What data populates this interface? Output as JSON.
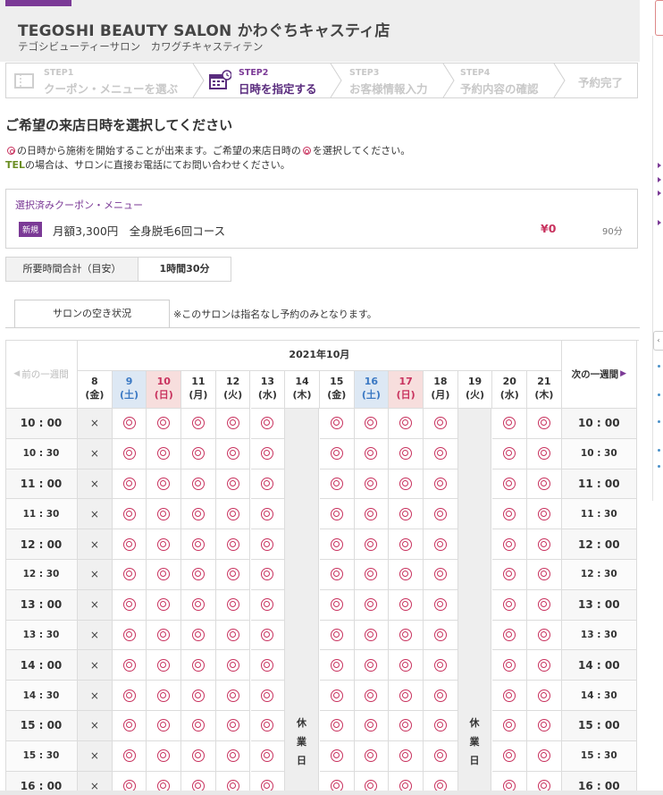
{
  "salon": {
    "name": "TEGOSHI BEAUTY SALON かわぐちキャスティ店",
    "kana": "テゴシビューティーサロン　カワグチキャスティテン"
  },
  "steps": [
    {
      "num": "STEP1",
      "label": "クーポン・メニューを選ぶ",
      "state": "done"
    },
    {
      "num": "STEP2",
      "label": "日時を指定する",
      "state": "active"
    },
    {
      "num": "STEP3",
      "label": "お客様情報入力",
      "state": "todo"
    },
    {
      "num": "STEP4",
      "label": "予約内容の確認",
      "state": "todo"
    },
    {
      "num": "",
      "label": "予約完了",
      "state": "todo"
    }
  ],
  "section_title": "ご希望の来店日時を選択してください",
  "notes": {
    "line1_a": "の日時から施術を開始することが出来ます。ご希望の来店日時の",
    "line1_b": "を選択してください。",
    "line2_tel": "TEL",
    "line2_rest": "の場合は、サロンに直接お電話にてお問い合わせください。"
  },
  "coupon": {
    "heading": "選択済みクーポン・メニュー",
    "badge": "新規",
    "name": "月額3,300円　全身脱毛6回コース",
    "price": "¥0",
    "minutes": "90分"
  },
  "duration": {
    "label": "所要時間合計（目安）",
    "value": "1時間30分"
  },
  "tab": {
    "label": "サロンの空き状況",
    "note": "※このサロンは指名なし予約のみとなります。"
  },
  "calendar": {
    "month": "2021年10月",
    "prev_week": "前の一週間",
    "next_week": "次の一週間",
    "closed_label": [
      "休",
      "業",
      "日"
    ],
    "days": [
      {
        "d": "8",
        "w": "(金)",
        "type": "weekday",
        "closed": false,
        "unavailable": true
      },
      {
        "d": "9",
        "w": "(土)",
        "type": "sat",
        "closed": false,
        "unavailable": false
      },
      {
        "d": "10",
        "w": "(日)",
        "type": "sun",
        "closed": false,
        "unavailable": false
      },
      {
        "d": "11",
        "w": "(月)",
        "type": "weekday",
        "closed": false,
        "unavailable": false
      },
      {
        "d": "12",
        "w": "(火)",
        "type": "weekday",
        "closed": false,
        "unavailable": false
      },
      {
        "d": "13",
        "w": "(水)",
        "type": "weekday",
        "closed": false,
        "unavailable": false
      },
      {
        "d": "14",
        "w": "(木)",
        "type": "weekday",
        "closed": true,
        "unavailable": false
      },
      {
        "d": "15",
        "w": "(金)",
        "type": "weekday",
        "closed": false,
        "unavailable": false
      },
      {
        "d": "16",
        "w": "(土)",
        "type": "sat",
        "closed": false,
        "unavailable": false
      },
      {
        "d": "17",
        "w": "(日)",
        "type": "sun",
        "closed": false,
        "unavailable": false
      },
      {
        "d": "18",
        "w": "(月)",
        "type": "weekday",
        "closed": false,
        "unavailable": false
      },
      {
        "d": "19",
        "w": "(火)",
        "type": "weekday",
        "closed": true,
        "unavailable": false
      },
      {
        "d": "20",
        "w": "(水)",
        "type": "weekday",
        "closed": false,
        "unavailable": false
      },
      {
        "d": "21",
        "w": "(木)",
        "type": "weekday",
        "closed": false,
        "unavailable": false
      }
    ],
    "times": [
      "10 : 00",
      "10 : 30",
      "11 : 00",
      "11 : 30",
      "12 : 00",
      "12 : 30",
      "13 : 00",
      "13 : 30",
      "14 : 00",
      "14 : 30",
      "15 : 00",
      "15 : 30",
      "16 : 00"
    ],
    "unavailable_mark": "×"
  },
  "colors": {
    "brand": "#7b3a96",
    "mark": "#c8325e",
    "saturday_bg": "#dde8f4",
    "sunday_bg": "#f7dedd"
  }
}
